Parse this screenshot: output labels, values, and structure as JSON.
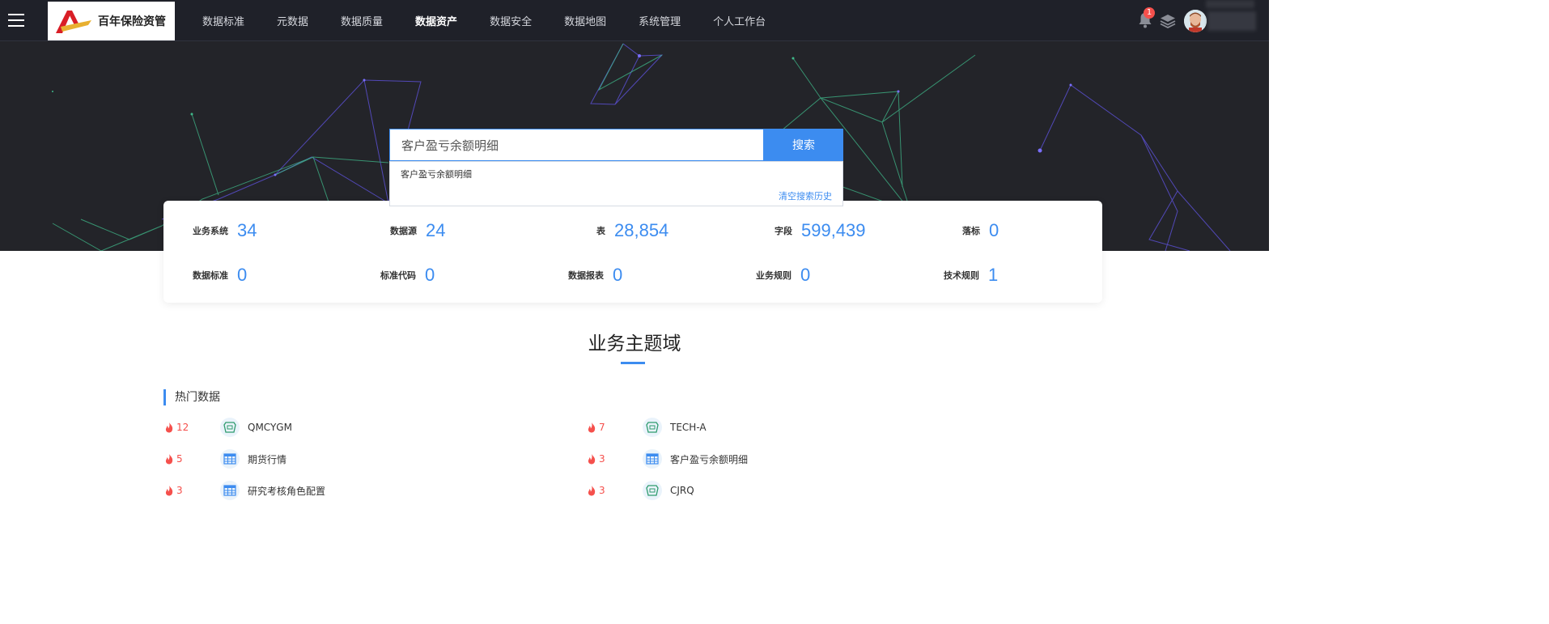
{
  "nav": {
    "brand": "百年保险资管",
    "menu": [
      "数据标准",
      "元数据",
      "数据质量",
      "数据资产",
      "数据安全",
      "数据地图",
      "系统管理",
      "个人工作台"
    ],
    "active": "数据资产",
    "notification_count": "1"
  },
  "search": {
    "value": "客户盈亏余额明细",
    "button": "搜索",
    "history": [
      "客户盈亏余额明细"
    ],
    "clear_label": "清空搜索历史"
  },
  "stats": [
    {
      "label": "业务系统",
      "value": "34"
    },
    {
      "label": "数据源",
      "value": "24"
    },
    {
      "label": "表",
      "value": "28,854"
    },
    {
      "label": "字段",
      "value": "599,439"
    },
    {
      "label": "落标",
      "value": "0"
    },
    {
      "label": "数据标准",
      "value": "0"
    },
    {
      "label": "标准代码",
      "value": "0"
    },
    {
      "label": "数据报表",
      "value": "0"
    },
    {
      "label": "业务规则",
      "value": "0"
    },
    {
      "label": "技术规则",
      "value": "1"
    }
  ],
  "section_title": "业务主题域",
  "hot": {
    "title": "热门数据",
    "items": [
      {
        "count": "12",
        "name": "QMCYGM",
        "icon": "database-icon"
      },
      {
        "count": "7",
        "name": "TECH-A",
        "icon": "database-icon"
      },
      {
        "count": "5",
        "name": "期货行情",
        "icon": "table-icon"
      },
      {
        "count": "3",
        "name": "客户盈亏余额明细",
        "icon": "table-icon"
      },
      {
        "count": "3",
        "name": "研究考核角色配置",
        "icon": "table-icon"
      },
      {
        "count": "3",
        "name": "CJRQ",
        "icon": "database-icon"
      }
    ]
  },
  "colors": {
    "accent": "#3c8cf0",
    "hot": "#f5504c",
    "nav_bg": "#1f2129",
    "hero_bg": "#232429"
  }
}
